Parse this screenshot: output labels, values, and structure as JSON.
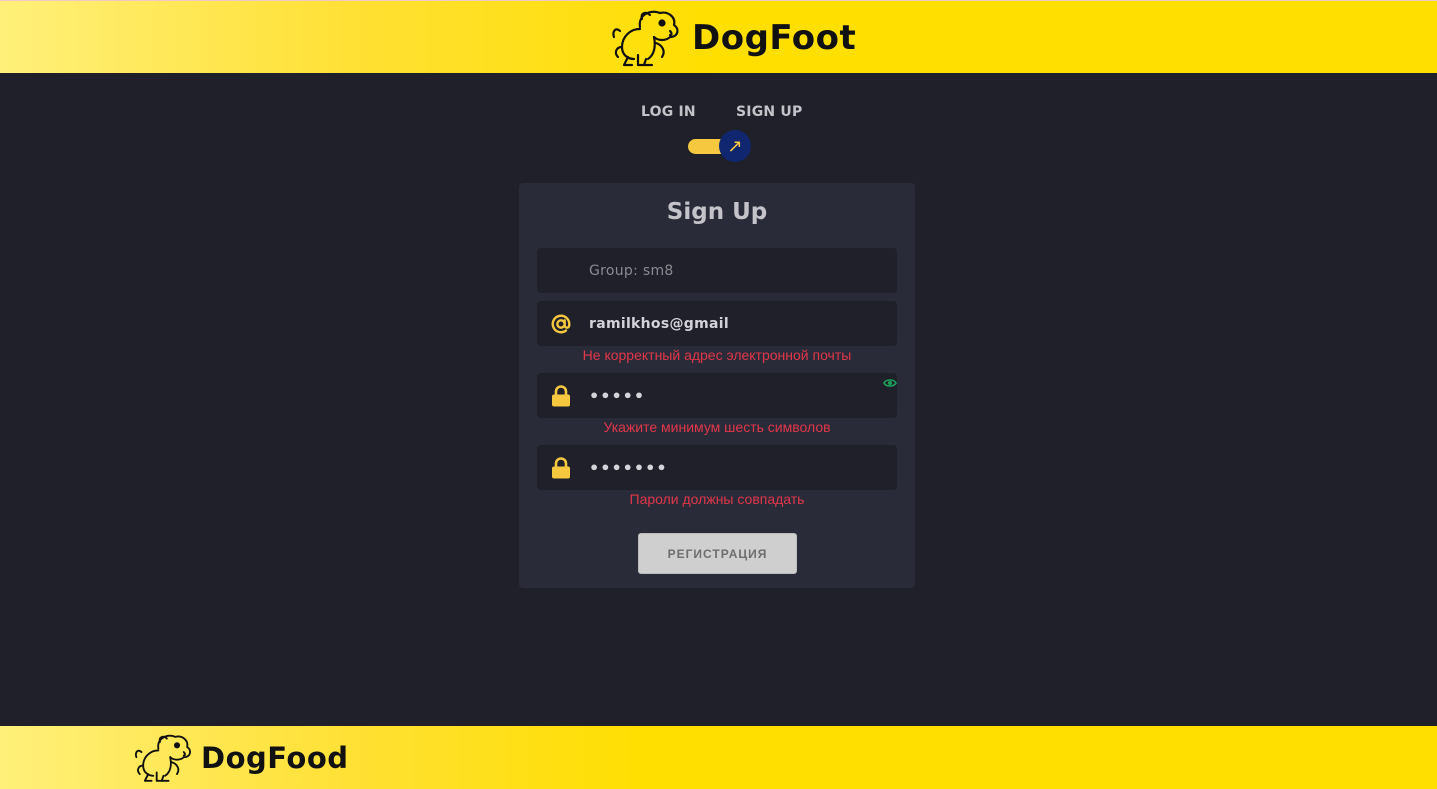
{
  "header": {
    "logo_text": "DogFoot"
  },
  "auth_mode": {
    "login_label": "LOG IN",
    "signup_label": "SIGN UP",
    "toggle_glyph": "↗"
  },
  "signup_form": {
    "title": "Sign Up",
    "group_field": {
      "placeholder": "Group: sm8"
    },
    "email_field": {
      "value": "ramilkhos@gmail",
      "icon": "at-icon"
    },
    "email_error": "Не корректный адрес электронной почты",
    "password_field": {
      "value": "•••••",
      "icon": "lock-icon"
    },
    "password_error": "Укажите минимум шесть символов",
    "confirm_field": {
      "value": "•••••••",
      "icon": "lock-icon"
    },
    "confirm_error": "Пароли должны совпадать",
    "submit_label": "РЕГИСТРАЦИЯ"
  },
  "footer": {
    "logo_text": "DogFood"
  },
  "colors": {
    "accent_yellow": "#ffdf00",
    "icon_yellow": "#f6c840",
    "background": "#1f2029",
    "card": "#2a2b38",
    "error": "#e2364a",
    "toggle_knob": "#102770",
    "eye_green": "#1aa05a"
  }
}
